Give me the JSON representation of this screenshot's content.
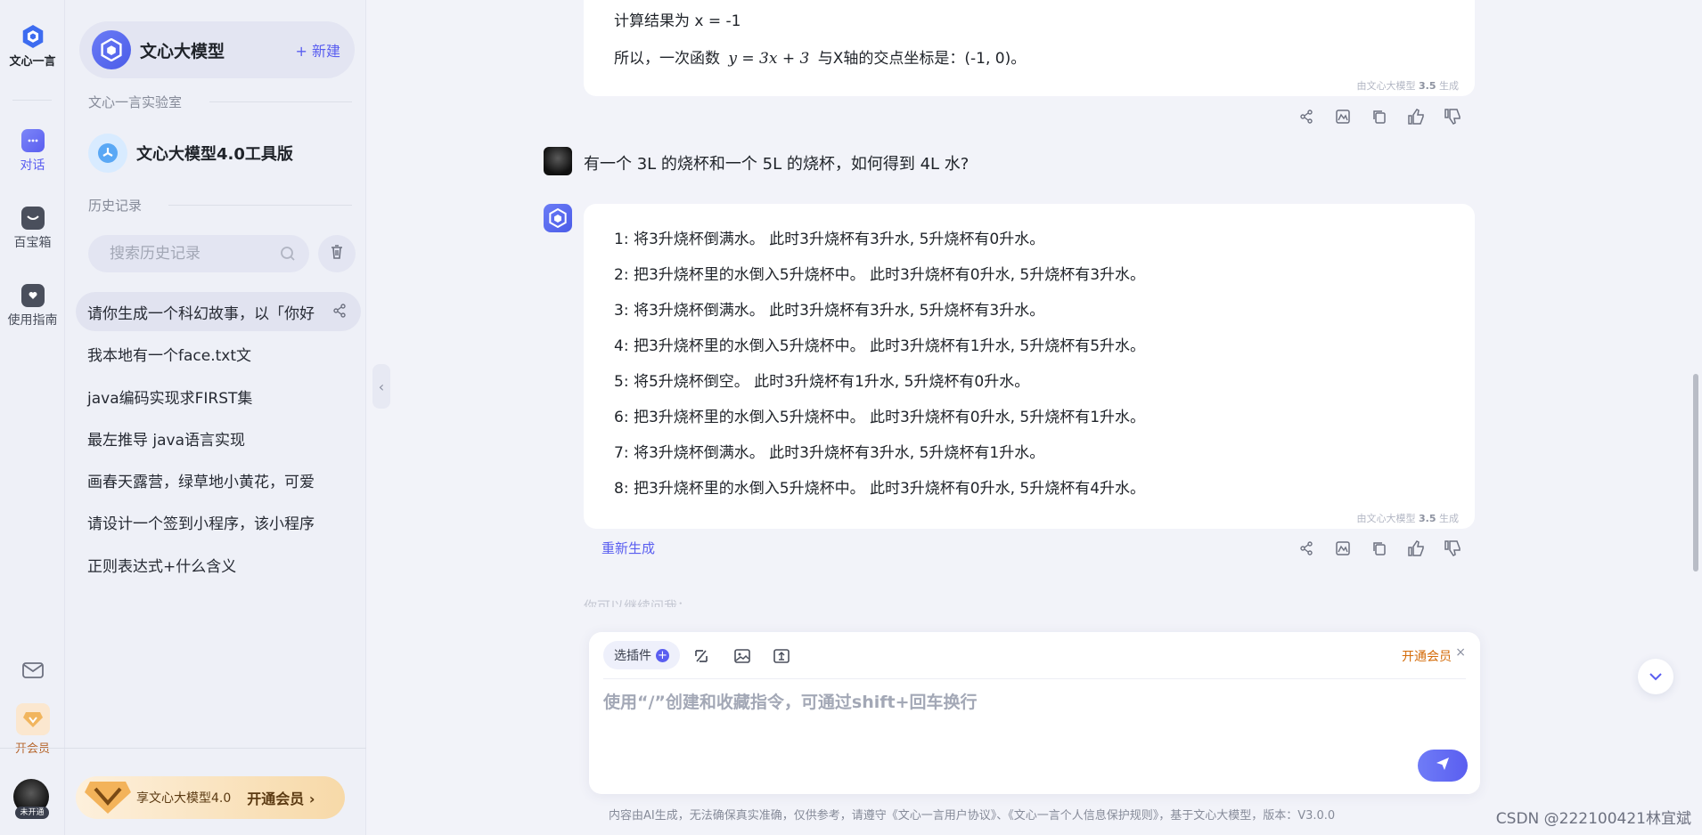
{
  "rail": {
    "logo_label": "文心一言",
    "items": [
      {
        "label": "对话",
        "icon": "chat-icon"
      },
      {
        "label": "百宝箱",
        "icon": "toolbox-icon"
      },
      {
        "label": "使用指南",
        "icon": "guide-icon"
      }
    ],
    "vip_label": "开会员",
    "avatar_badge": "未开通"
  },
  "sidebar": {
    "brand": "文心大模型",
    "new_label": "+ 新建",
    "lab_section": "文心一言实验室",
    "lab_item": "文心大模型4.0工具版",
    "history_section": "历史记录",
    "search_placeholder": "搜索历史记录",
    "history": [
      "请你生成一个科幻故事，以「你好",
      "我本地有一个face.txt文",
      "java编码实现求FIRST集",
      "最左推导 java语言实现",
      "画春天露营，绿草地小黄花，可爱",
      "请设计一个签到小程序，该小程序",
      "正则表达式+什么含义"
    ],
    "vip_banner_text": "享文心大模型4.0",
    "vip_banner_cta": "开通会员 ›"
  },
  "chat": {
    "prev_answer": {
      "line1": "计算结果为 x = -1",
      "line2_prefix": "所以，一次函数",
      "line2_math": "y = 3x + 3",
      "line2_suffix": "与X轴的交点坐标是：(-1, 0)。",
      "meta_prefix": "由文心大模型",
      "meta_version": "3.5",
      "meta_suffix": "生成"
    },
    "user_question": "有一个 3L 的烧杯和一个 5L 的烧杯，如何得到 4L 水?",
    "answer_steps": [
      "1: 将3升烧杯倒满水。 此时3升烧杯有3升水, 5升烧杯有0升水。",
      "2: 把3升烧杯里的水倒入5升烧杯中。 此时3升烧杯有0升水, 5升烧杯有3升水。",
      "3: 将3升烧杯倒满水。 此时3升烧杯有3升水, 5升烧杯有3升水。",
      "4: 把3升烧杯里的水倒入5升烧杯中。 此时3升烧杯有1升水, 5升烧杯有5升水。",
      "5: 将5升烧杯倒空。 此时3升烧杯有1升水, 5升烧杯有0升水。",
      "6: 把3升烧杯里的水倒入5升烧杯中。 此时3升烧杯有0升水, 5升烧杯有1升水。",
      "7: 将3升烧杯倒满水。 此时3升烧杯有3升水, 5升烧杯有1升水。",
      "8: 把3升烧杯里的水倒入5升烧杯中。 此时3升烧杯有0升水, 5升烧杯有4升水。"
    ],
    "answer_meta_prefix": "由文心大模型",
    "answer_meta_version": "3.5",
    "answer_meta_suffix": "生成",
    "regenerate": "重新生成",
    "followup": "你可以继续问我："
  },
  "composer": {
    "plugin_label": "选插件",
    "vip_label": "开通会员",
    "close": "×",
    "placeholder": "使用“/”创建和收藏指令，可通过shift+回车换行"
  },
  "footer": {
    "note": "内容由AI生成，无法确保真实准确，仅供参考，请遵守《文心一言用户协议》、《文心一言个人信息保护规则》，基于文心大模型，版本：V3.0.0"
  },
  "watermark": "CSDN @222100421林宜斌",
  "colors": {
    "accent": "#5a5ef0",
    "vip": "#d46b08",
    "background": "#f2f3f9"
  }
}
